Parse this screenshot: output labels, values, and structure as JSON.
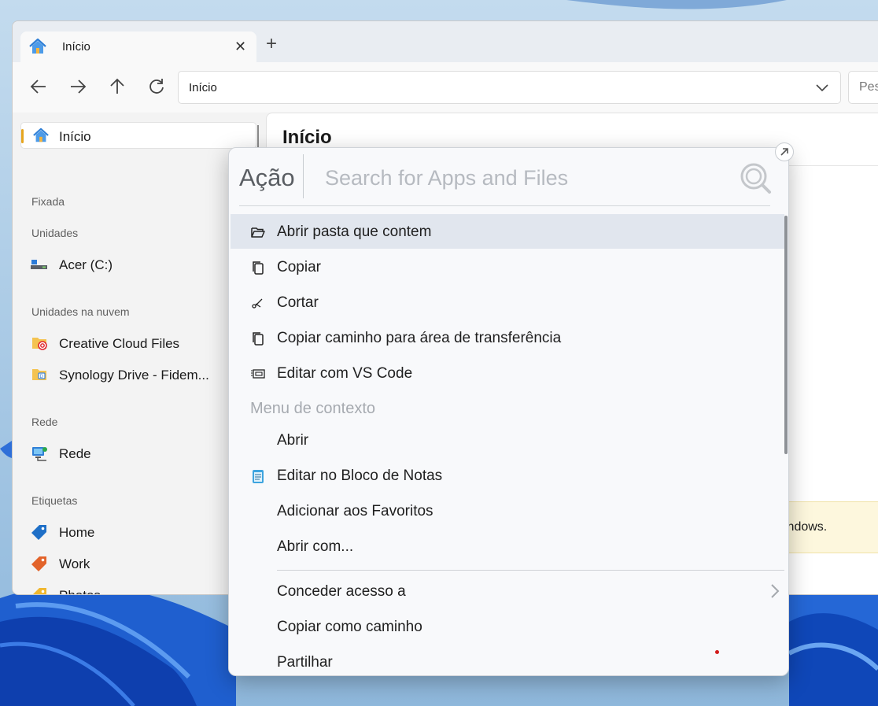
{
  "explorer": {
    "tab_title": "Início",
    "address": "Início",
    "search_placeholder": "Pesquisar em Início",
    "main_title": "Início",
    "banner_text": "indows."
  },
  "sidebar": {
    "selected": "Início",
    "sections": {
      "pinned": "Fixada",
      "drives": "Unidades",
      "cloud": "Unidades na nuvem",
      "network": "Rede",
      "tags": "Etiquetas"
    },
    "items": {
      "drive_c": "Acer (C:)",
      "creative_cloud": "Creative Cloud Files",
      "synology": "Synology Drive - Fidem...",
      "rede": "Rede",
      "tag_home": "Home",
      "tag_work": "Work",
      "tag_photos": "Photos"
    },
    "tag_colors": {
      "home": "#1e6fc7",
      "work": "#e2632a",
      "photos": "#f0b72f"
    }
  },
  "launcher": {
    "mode_label": "Ação",
    "search_placeholder": "Search for Apps and Files",
    "actions": [
      {
        "label": "Abrir pasta que contem",
        "icon": "folder-open-icon"
      },
      {
        "label": "Copiar",
        "icon": "copy-icon"
      },
      {
        "label": "Cortar",
        "icon": "scissors-icon"
      },
      {
        "label": "Copiar caminho para área de transferência",
        "icon": "copy-icon"
      },
      {
        "label": "Editar com VS Code",
        "icon": "vscode-icon"
      }
    ],
    "context_section": "Menu de contexto",
    "context_items": [
      {
        "label": "Abrir",
        "icon": ""
      },
      {
        "label": "Editar no Bloco de Notas",
        "icon": "notepad-icon"
      },
      {
        "label": "Adicionar aos Favoritos",
        "icon": ""
      },
      {
        "label": "Abrir com...",
        "icon": ""
      },
      {
        "label": "Conceder acesso a",
        "icon": "",
        "submenu": true
      },
      {
        "label": "Copiar como caminho",
        "icon": ""
      },
      {
        "label": "Partilhar",
        "icon": ""
      }
    ]
  }
}
